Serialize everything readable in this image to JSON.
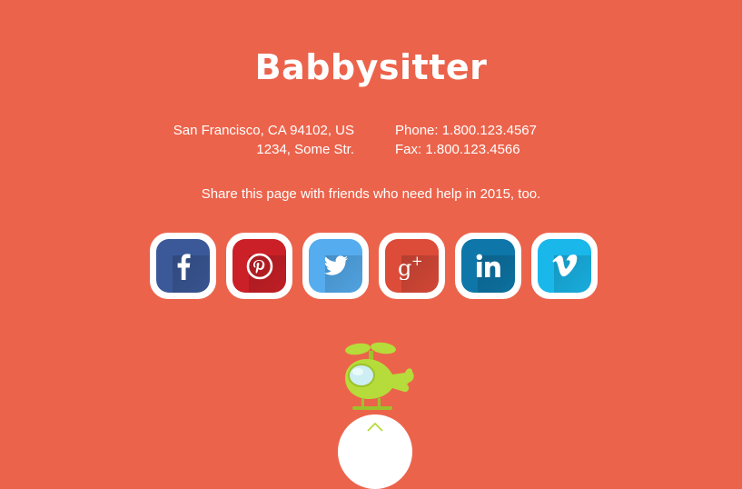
{
  "brand": {
    "title": "Babbysitter"
  },
  "address": {
    "line1": "San Francisco, CA 94102, US",
    "line2": "1234, Some Str."
  },
  "contact": {
    "phone": "Phone: 1.800.123.4567",
    "fax": "Fax: 1.800.123.4566"
  },
  "share": {
    "text": "Share this page with friends who need help in 2015, too."
  },
  "socials": [
    {
      "name": "facebook",
      "icon": "facebook-icon",
      "color": "#3b5998"
    },
    {
      "name": "pinterest",
      "icon": "pinterest-icon",
      "color": "#cb2027"
    },
    {
      "name": "twitter",
      "icon": "twitter-icon",
      "color": "#55acee"
    },
    {
      "name": "google-plus",
      "icon": "google-plus-icon",
      "color": "#dd4b39"
    },
    {
      "name": "linkedin",
      "icon": "linkedin-icon",
      "color": "#0e76a8"
    },
    {
      "name": "vimeo",
      "icon": "vimeo-icon",
      "color": "#1ab7ea"
    }
  ],
  "colors": {
    "background": "#ec634b",
    "text": "#ffffff",
    "helicopter": "#b5dc3a"
  },
  "decor": {
    "helicopter_icon": "helicopter-icon",
    "scroll_top_icon": "chevron-up-icon"
  }
}
